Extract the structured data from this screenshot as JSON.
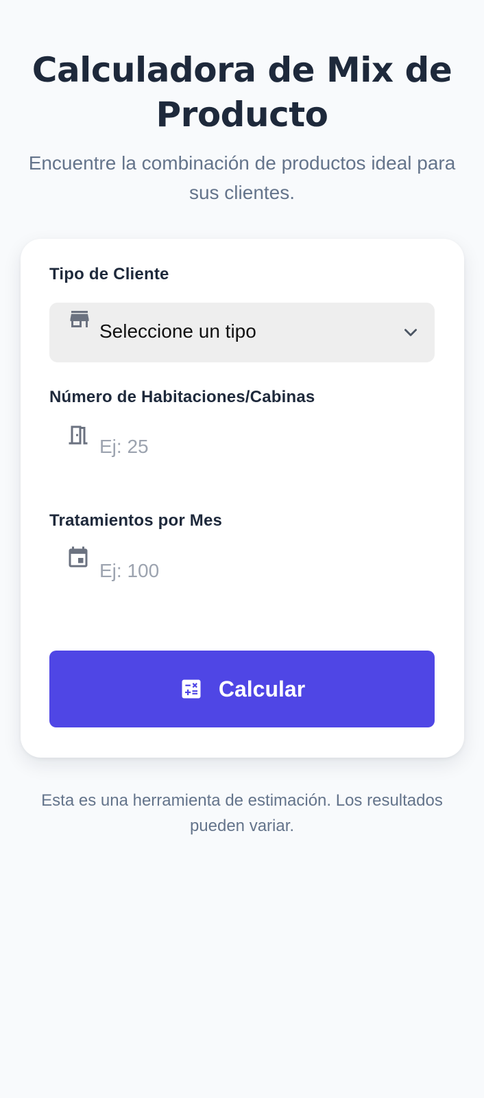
{
  "header": {
    "title": "Calculadora de Mix de Producto",
    "subtitle": "Encuentre la combinación de productos ideal para sus clientes."
  },
  "form": {
    "client_type": {
      "label": "Tipo de Cliente",
      "selected_value": "Seleccione un tipo",
      "icon": "store-icon"
    },
    "rooms": {
      "label": "Número de Habitaciones/Cabinas",
      "placeholder": "Ej: 25",
      "icon": "door-icon"
    },
    "treatments": {
      "label": "Tratamientos por Mes",
      "placeholder": "Ej: 100",
      "icon": "calendar-icon"
    },
    "submit": {
      "label": "Calcular",
      "icon": "calculator-icon"
    }
  },
  "footer": {
    "note": "Esta es una herramienta de estimación. Los resultados pueden variar."
  },
  "colors": {
    "background": "#f8fafc",
    "card": "#ffffff",
    "title": "#1e293b",
    "muted": "#64748b",
    "accent": "#4f46e5",
    "icon": "#6b7280",
    "select_bg": "#eeeeee"
  }
}
